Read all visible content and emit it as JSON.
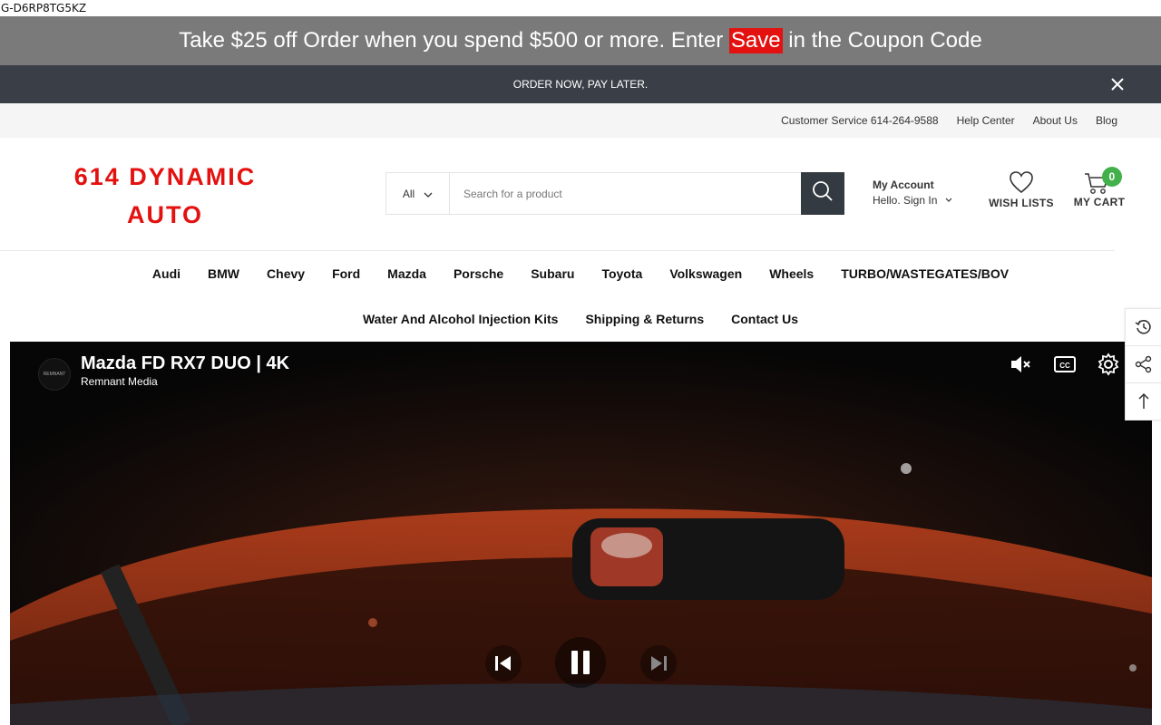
{
  "gtm_id": "G-D6RP8TG5KZ",
  "promo": {
    "text_before": "Take $25 off Order when you spend $500 or more. Enter ",
    "highlight": "Save",
    "text_after": " in the Coupon Code",
    "bar_color": "#7a7a7a",
    "highlight_color": "#e3110f"
  },
  "pay_later": {
    "text": "ORDER NOW, PAY LATER.",
    "close_icon": "close-icon"
  },
  "top_links": [
    "Customer Service 614-264-9588",
    "Help Center",
    "About Us",
    "Blog"
  ],
  "logo": {
    "line1": "614 DYNAMIC",
    "line2": "AUTO",
    "color": "#e3110f"
  },
  "search": {
    "category": "All",
    "placeholder": "Search for a product",
    "button_icon": "search-icon"
  },
  "account": {
    "title": "My Account",
    "subtitle": "Hello. Sign In"
  },
  "wishlist": {
    "label": "WISH LISTS",
    "icon": "heart-icon"
  },
  "cart": {
    "label": "MY CART",
    "count": "0",
    "icon": "cart-icon",
    "badge_color": "#43b14b"
  },
  "nav": {
    "row1": [
      "Audi",
      "BMW",
      "Chevy",
      "Ford",
      "Mazda",
      "Porsche",
      "Subaru",
      "Toyota",
      "Volkswagen",
      "Wheels",
      "TURBO/WASTEGATES/BOV"
    ],
    "row2": [
      "Water And Alcohol Injection Kits",
      "Shipping & Returns",
      "Contact Us"
    ]
  },
  "video": {
    "title": "Mazda FD RX7 DUO | 4K",
    "channel": "Remnant Media",
    "channel_logo_text": "REMNANT",
    "controls": [
      "mute-icon",
      "captions-icon",
      "settings-icon"
    ],
    "playback": [
      "previous-icon",
      "pause-icon",
      "next-icon"
    ]
  },
  "side_tools": [
    "history-icon",
    "share-icon",
    "back-to-top-icon"
  ]
}
